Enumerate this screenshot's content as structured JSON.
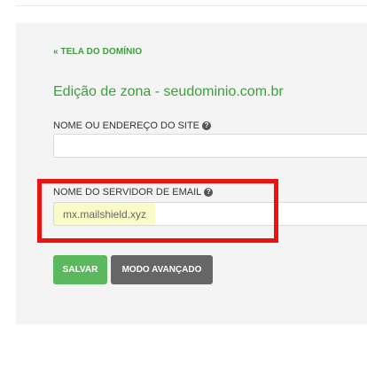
{
  "nav": {
    "back_label": "« TELA DO DOMÍNIO"
  },
  "page": {
    "title": "Edição de zona - seudominio.com.br"
  },
  "form": {
    "site_field": {
      "label": "NOME OU ENDEREÇO DO SITE",
      "value": ""
    },
    "mail_field": {
      "label": "NOME DO SERVIDOR DE EMAIL",
      "value": "mx.mailshield.xyz"
    },
    "help_glyph": "?"
  },
  "buttons": {
    "save_label": "SALVAR",
    "advanced_label": "MODO AVANÇADO"
  },
  "colors": {
    "accent_green": "#3c9e3c",
    "save_button": "#5cb85c",
    "advanced_button": "#666666",
    "highlight_border": "#ee1111",
    "autofill": "#fbfbc8"
  }
}
